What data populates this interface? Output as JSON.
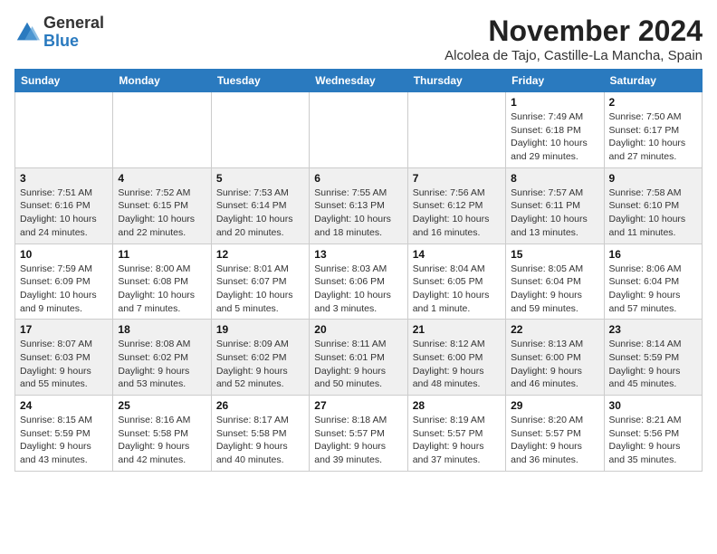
{
  "header": {
    "logo_general": "General",
    "logo_blue": "Blue",
    "month_title": "November 2024",
    "subtitle": "Alcolea de Tajo, Castille-La Mancha, Spain"
  },
  "days_of_week": [
    "Sunday",
    "Monday",
    "Tuesday",
    "Wednesday",
    "Thursday",
    "Friday",
    "Saturday"
  ],
  "weeks": [
    {
      "row_class": "row-odd",
      "days": [
        {
          "num": "",
          "info": ""
        },
        {
          "num": "",
          "info": ""
        },
        {
          "num": "",
          "info": ""
        },
        {
          "num": "",
          "info": ""
        },
        {
          "num": "",
          "info": ""
        },
        {
          "num": "1",
          "info": "Sunrise: 7:49 AM\nSunset: 6:18 PM\nDaylight: 10 hours and 29 minutes."
        },
        {
          "num": "2",
          "info": "Sunrise: 7:50 AM\nSunset: 6:17 PM\nDaylight: 10 hours and 27 minutes."
        }
      ]
    },
    {
      "row_class": "row-even",
      "days": [
        {
          "num": "3",
          "info": "Sunrise: 7:51 AM\nSunset: 6:16 PM\nDaylight: 10 hours and 24 minutes."
        },
        {
          "num": "4",
          "info": "Sunrise: 7:52 AM\nSunset: 6:15 PM\nDaylight: 10 hours and 22 minutes."
        },
        {
          "num": "5",
          "info": "Sunrise: 7:53 AM\nSunset: 6:14 PM\nDaylight: 10 hours and 20 minutes."
        },
        {
          "num": "6",
          "info": "Sunrise: 7:55 AM\nSunset: 6:13 PM\nDaylight: 10 hours and 18 minutes."
        },
        {
          "num": "7",
          "info": "Sunrise: 7:56 AM\nSunset: 6:12 PM\nDaylight: 10 hours and 16 minutes."
        },
        {
          "num": "8",
          "info": "Sunrise: 7:57 AM\nSunset: 6:11 PM\nDaylight: 10 hours and 13 minutes."
        },
        {
          "num": "9",
          "info": "Sunrise: 7:58 AM\nSunset: 6:10 PM\nDaylight: 10 hours and 11 minutes."
        }
      ]
    },
    {
      "row_class": "row-odd",
      "days": [
        {
          "num": "10",
          "info": "Sunrise: 7:59 AM\nSunset: 6:09 PM\nDaylight: 10 hours and 9 minutes."
        },
        {
          "num": "11",
          "info": "Sunrise: 8:00 AM\nSunset: 6:08 PM\nDaylight: 10 hours and 7 minutes."
        },
        {
          "num": "12",
          "info": "Sunrise: 8:01 AM\nSunset: 6:07 PM\nDaylight: 10 hours and 5 minutes."
        },
        {
          "num": "13",
          "info": "Sunrise: 8:03 AM\nSunset: 6:06 PM\nDaylight: 10 hours and 3 minutes."
        },
        {
          "num": "14",
          "info": "Sunrise: 8:04 AM\nSunset: 6:05 PM\nDaylight: 10 hours and 1 minute."
        },
        {
          "num": "15",
          "info": "Sunrise: 8:05 AM\nSunset: 6:04 PM\nDaylight: 9 hours and 59 minutes."
        },
        {
          "num": "16",
          "info": "Sunrise: 8:06 AM\nSunset: 6:04 PM\nDaylight: 9 hours and 57 minutes."
        }
      ]
    },
    {
      "row_class": "row-even",
      "days": [
        {
          "num": "17",
          "info": "Sunrise: 8:07 AM\nSunset: 6:03 PM\nDaylight: 9 hours and 55 minutes."
        },
        {
          "num": "18",
          "info": "Sunrise: 8:08 AM\nSunset: 6:02 PM\nDaylight: 9 hours and 53 minutes."
        },
        {
          "num": "19",
          "info": "Sunrise: 8:09 AM\nSunset: 6:02 PM\nDaylight: 9 hours and 52 minutes."
        },
        {
          "num": "20",
          "info": "Sunrise: 8:11 AM\nSunset: 6:01 PM\nDaylight: 9 hours and 50 minutes."
        },
        {
          "num": "21",
          "info": "Sunrise: 8:12 AM\nSunset: 6:00 PM\nDaylight: 9 hours and 48 minutes."
        },
        {
          "num": "22",
          "info": "Sunrise: 8:13 AM\nSunset: 6:00 PM\nDaylight: 9 hours and 46 minutes."
        },
        {
          "num": "23",
          "info": "Sunrise: 8:14 AM\nSunset: 5:59 PM\nDaylight: 9 hours and 45 minutes."
        }
      ]
    },
    {
      "row_class": "row-odd",
      "days": [
        {
          "num": "24",
          "info": "Sunrise: 8:15 AM\nSunset: 5:59 PM\nDaylight: 9 hours and 43 minutes."
        },
        {
          "num": "25",
          "info": "Sunrise: 8:16 AM\nSunset: 5:58 PM\nDaylight: 9 hours and 42 minutes."
        },
        {
          "num": "26",
          "info": "Sunrise: 8:17 AM\nSunset: 5:58 PM\nDaylight: 9 hours and 40 minutes."
        },
        {
          "num": "27",
          "info": "Sunrise: 8:18 AM\nSunset: 5:57 PM\nDaylight: 9 hours and 39 minutes."
        },
        {
          "num": "28",
          "info": "Sunrise: 8:19 AM\nSunset: 5:57 PM\nDaylight: 9 hours and 37 minutes."
        },
        {
          "num": "29",
          "info": "Sunrise: 8:20 AM\nSunset: 5:57 PM\nDaylight: 9 hours and 36 minutes."
        },
        {
          "num": "30",
          "info": "Sunrise: 8:21 AM\nSunset: 5:56 PM\nDaylight: 9 hours and 35 minutes."
        }
      ]
    }
  ]
}
